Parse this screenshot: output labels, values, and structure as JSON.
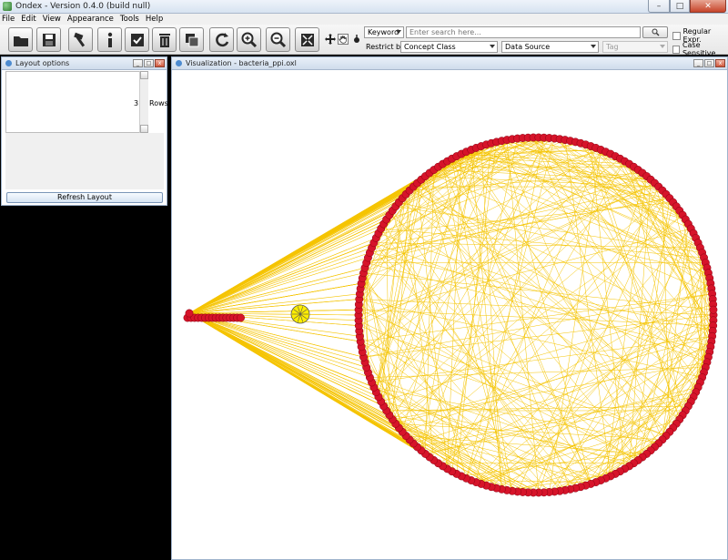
{
  "window": {
    "title": "Ondex - Version 0.4.0 (build null)",
    "min_label": "–",
    "max_label": "□",
    "close_label": "✕"
  },
  "menu": [
    "File",
    "Edit",
    "View",
    "Appearance",
    "Tools",
    "Help"
  ],
  "toolbar_icons": [
    "open-folder-icon",
    "save-icon",
    "hammer-icon",
    "info-icon",
    "checkbox-icon",
    "trash-icon",
    "copy-icon",
    "refresh-icon",
    "zoom-in-icon",
    "zoom-out-icon",
    "fit-view-icon",
    "move-icon",
    "hand-icon",
    "pointer-icon"
  ],
  "search": {
    "mode": "Keyword",
    "placeholder": "Enter search here...",
    "regex_label": "Regular Expr.",
    "case_label": "Case Sensitive",
    "restrict_label": "Restrict by:",
    "concept_class": "Concept Class",
    "data_source": "Data Source",
    "tag": "Tag"
  },
  "layout_options": {
    "title": "Layout options",
    "rows_value": "3",
    "rows_label": "Rows",
    "refresh_label": "Refresh Layout"
  },
  "visualization": {
    "title": "Visualization - bacteria_ppi.oxl"
  },
  "colors": {
    "edge": "#f5c400",
    "node": "#d6142a",
    "node_stroke": "#8a0010",
    "yellow_node": "#ffee00"
  }
}
